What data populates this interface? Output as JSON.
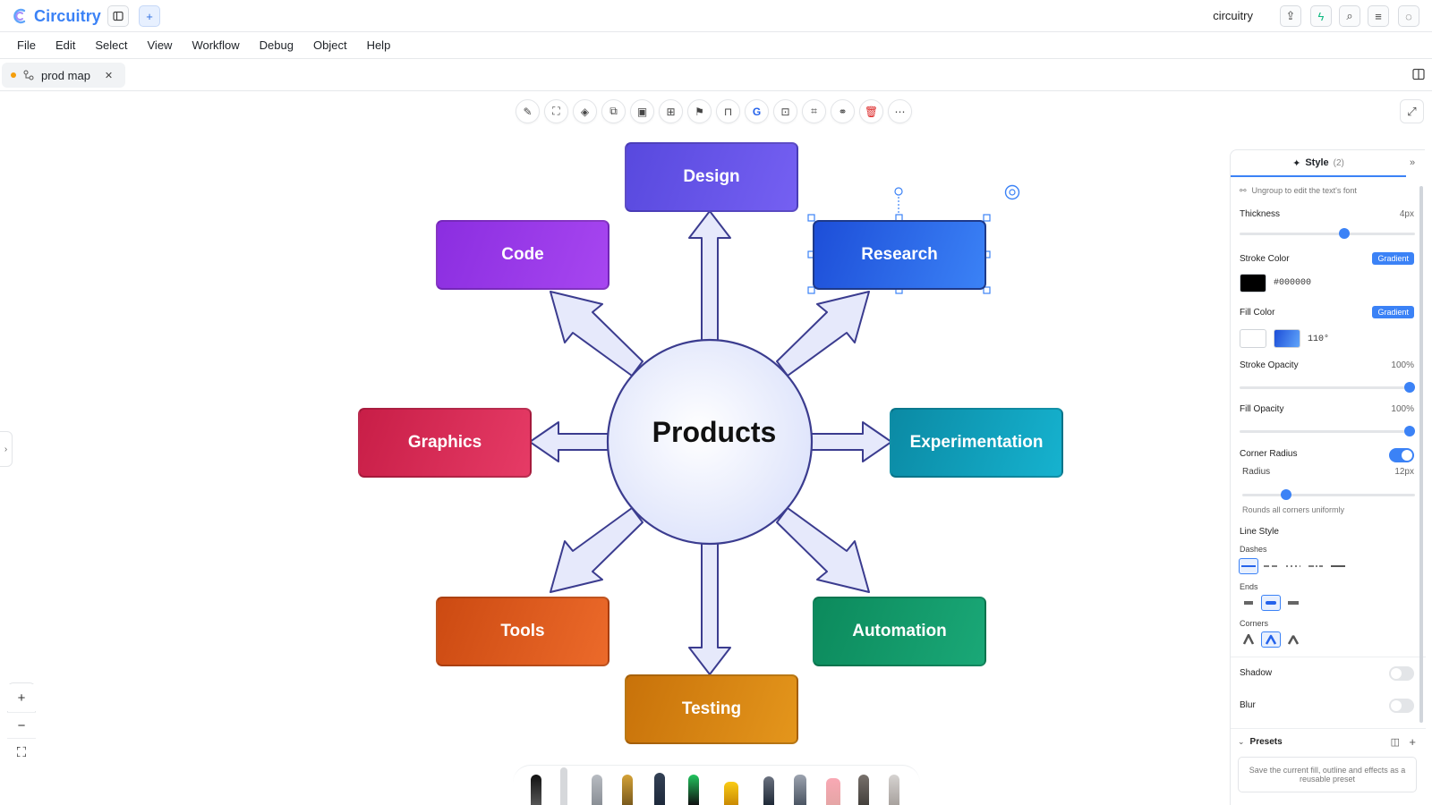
{
  "titlebar": {
    "app_name": "Circuitry",
    "user": "circuitry"
  },
  "menu": [
    "File",
    "Edit",
    "Select",
    "View",
    "Workflow",
    "Debug",
    "Object",
    "Help"
  ],
  "tab": {
    "label": "prod map",
    "close": "✕"
  },
  "diagram": {
    "center": "Products",
    "nodes": {
      "design": "Design",
      "code": "Code",
      "research": "Research",
      "graphics": "Graphics",
      "experimentation": "Experimentation",
      "tools": "Tools",
      "automation": "Automation",
      "testing": "Testing"
    }
  },
  "panel": {
    "tab_label": "Style",
    "tab_count": "(2)",
    "hint": "Ungroup to edit the text's font",
    "thickness": {
      "label": "Thickness",
      "value": "4px"
    },
    "stroke_color": {
      "label": "Stroke Color",
      "button": "Gradient",
      "hex": "#000000"
    },
    "fill_color": {
      "label": "Fill Color",
      "button": "Gradient",
      "angle": "110°"
    },
    "stroke_opacity": {
      "label": "Stroke Opacity",
      "value": "100%"
    },
    "fill_opacity": {
      "label": "Fill Opacity",
      "value": "100%"
    },
    "corner_radius": {
      "label": "Corner Radius",
      "sub_label": "Radius",
      "value": "12px",
      "hint": "Rounds all corners uniformly"
    },
    "line_style": {
      "label": "Line Style",
      "dashes": "Dashes",
      "ends": "Ends",
      "corners": "Corners"
    },
    "shadow": "Shadow",
    "blur": "Blur",
    "presets": {
      "label": "Presets",
      "hint": "Save the current fill, outline and effects as a reusable preset"
    }
  },
  "colors": {
    "accent": "#3b82f6",
    "design": "#5b4ee0",
    "code": "#9333ea",
    "research": "#2f6fe6",
    "graphics": "#dc2f55",
    "experimentation": "#0ea5c0",
    "tools": "#e1571c",
    "automation": "#119668",
    "testing": "#d98512"
  }
}
